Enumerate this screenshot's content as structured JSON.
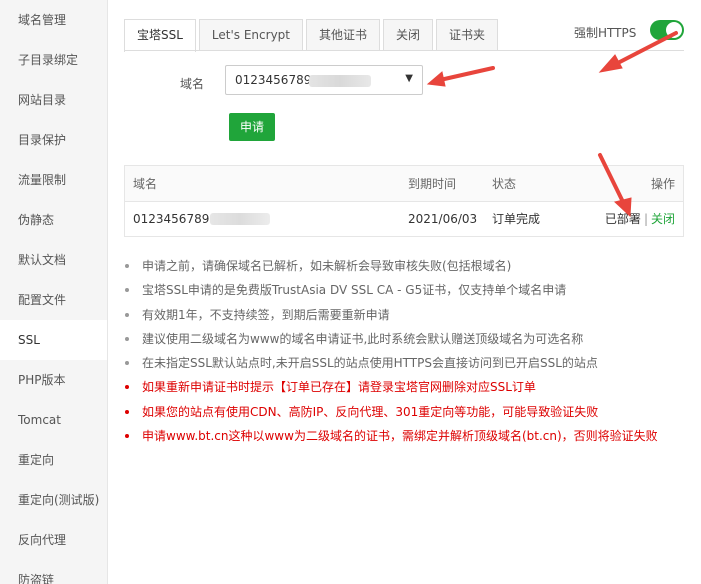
{
  "sidebar": {
    "items": [
      {
        "label": "域名管理",
        "active": false
      },
      {
        "label": "子目录绑定",
        "active": false
      },
      {
        "label": "网站目录",
        "active": false
      },
      {
        "label": "目录保护",
        "active": false
      },
      {
        "label": "流量限制",
        "active": false
      },
      {
        "label": "伪静态",
        "active": false
      },
      {
        "label": "默认文档",
        "active": false
      },
      {
        "label": "配置文件",
        "active": false
      },
      {
        "label": "SSL",
        "active": true
      },
      {
        "label": "PHP版本",
        "active": false
      },
      {
        "label": "Tomcat",
        "active": false
      },
      {
        "label": "重定向",
        "active": false
      },
      {
        "label": "重定向(测试版)",
        "active": false
      },
      {
        "label": "反向代理",
        "active": false
      },
      {
        "label": "防盗链",
        "active": false
      }
    ]
  },
  "tabs": [
    {
      "label": "宝塔SSL",
      "active": true
    },
    {
      "label": "Let's Encrypt",
      "active": false
    },
    {
      "label": "其他证书",
      "active": false
    },
    {
      "label": "关闭",
      "active": false
    },
    {
      "label": "证书夹",
      "active": false
    }
  ],
  "https": {
    "label": "强制HTTPS",
    "enabled": true
  },
  "form": {
    "domain_label": "域名",
    "domain_value": "0123456789.",
    "apply_label": "申请"
  },
  "table": {
    "headers": {
      "domain": "域名",
      "expire": "到期时间",
      "status": "状态",
      "action": "操作"
    },
    "rows": [
      {
        "domain": "0123456789.",
        "expire": "2021/06/03",
        "status": "订单完成",
        "deployed": "已部署",
        "close": "关闭"
      }
    ]
  },
  "notes": [
    {
      "text": "申请之前，请确保域名已解析，如未解析会导致审核失败(包括根域名)",
      "red": false
    },
    {
      "text": "宝塔SSL申请的是免费版TrustAsia DV SSL CA - G5证书，仅支持单个域名申请",
      "red": false
    },
    {
      "text": "有效期1年，不支持续签，到期后需要重新申请",
      "red": false
    },
    {
      "text": "建议使用二级域名为www的域名申请证书,此时系统会默认赠送顶级域名为可选名称",
      "red": false
    },
    {
      "text": "在未指定SSL默认站点时,未开启SSL的站点使用HTTPS会直接访问到已开启SSL的站点",
      "red": false
    },
    {
      "text": "如果重新申请证书时提示【订单已存在】请登录宝塔官网删除对应SSL订单",
      "red": true
    },
    {
      "text": "如果您的站点有使用CDN、高防IP、反向代理、301重定向等功能，可能导致验证失败",
      "red": true
    },
    {
      "text": "申请www.bt.cn这种以www为二级域名的证书，需绑定并解析顶级域名(bt.cn)，否则将验证失败",
      "red": true
    }
  ],
  "colors": {
    "accent": "#20a53a",
    "arrow": "#e8453c",
    "warning": "#dd0000"
  }
}
